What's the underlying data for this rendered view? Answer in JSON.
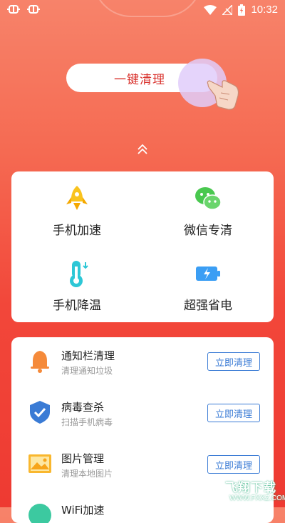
{
  "status_bar": {
    "time": "10:32"
  },
  "hero": {
    "clean_button_label": "一键清理"
  },
  "features": [
    {
      "label": "手机加速",
      "icon": "rocket-icon"
    },
    {
      "label": "微信专清",
      "icon": "wechat-icon"
    },
    {
      "label": "手机降温",
      "icon": "thermometer-icon"
    },
    {
      "label": "超强省电",
      "icon": "battery-icon"
    }
  ],
  "list": [
    {
      "title": "通知栏清理",
      "subtitle": "清理通知垃圾",
      "button": "立即清理",
      "icon": "bell-icon"
    },
    {
      "title": "病毒查杀",
      "subtitle": "扫描手机病毒",
      "button": "立即清理",
      "icon": "shield-icon"
    },
    {
      "title": "图片管理",
      "subtitle": "清理本地图片",
      "button": "立即清理",
      "icon": "picture-icon"
    },
    {
      "title": "WiFi加速",
      "icon": "wifi-icon"
    }
  ],
  "watermark": {
    "text": "飞翔下载",
    "url": "WWW.FXXZ.COM"
  },
  "colors": {
    "accent": "#d9322d",
    "button_blue": "#3a7bd5",
    "bg_top": "#f7836a",
    "bg_bottom": "#ee3a32"
  }
}
